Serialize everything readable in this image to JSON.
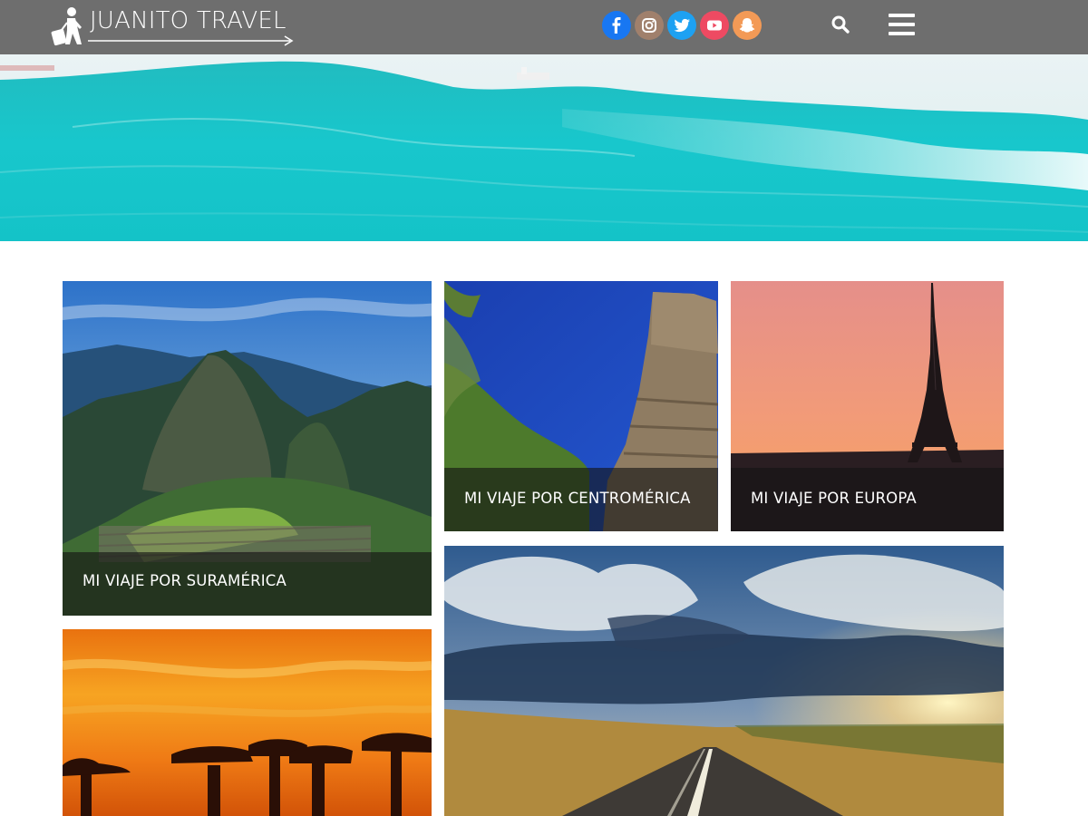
{
  "header": {
    "logo_text": "JUANITO TRAVEL",
    "background_color": "#6e6e6e",
    "social_links": [
      {
        "name": "facebook-icon",
        "color": "#1877f2"
      },
      {
        "name": "instagram-icon",
        "color": "#a0806c"
      },
      {
        "name": "twitter-icon",
        "color": "#1da1f2"
      },
      {
        "name": "youtube-icon",
        "color": "#ee4a62"
      },
      {
        "name": "snapchat-icon",
        "color": "#f39a56"
      }
    ],
    "search_icon": "search-icon",
    "menu_icon": "hamburger-menu-icon"
  },
  "hero": {
    "image": "turquoise-ocean-wave"
  },
  "cards": [
    {
      "label": "MI VIAJE POR SURAMÉRICA",
      "image": "machu-picchu"
    },
    {
      "label": "MI VIAJE POR CENTROMÉRICA",
      "image": "mayan-temple"
    },
    {
      "label": "MI VIAJE POR EUROPA",
      "image": "eiffel-tower-sunset"
    },
    {
      "label": "",
      "image": "baobab-sunset"
    },
    {
      "label": "",
      "image": "road-sunset"
    }
  ]
}
